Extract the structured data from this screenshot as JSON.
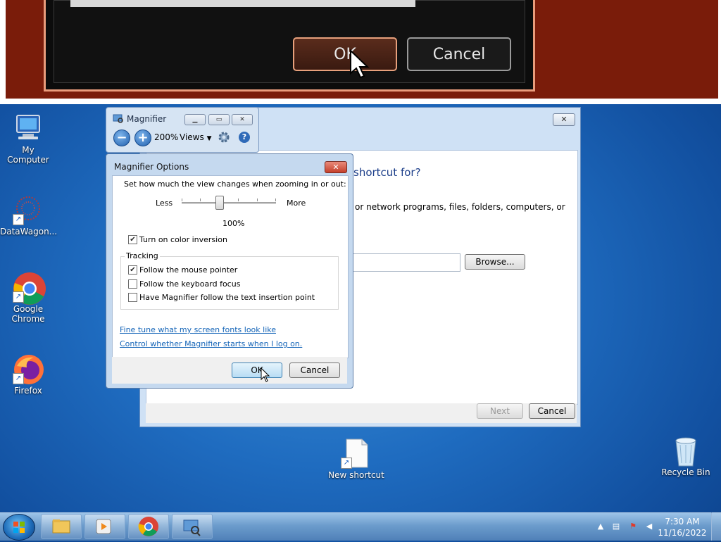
{
  "lens": {
    "ok_label": "OK",
    "cancel_label": "Cancel"
  },
  "desktop": {
    "icons": [
      {
        "label": "My Computer"
      },
      {
        "label": "DataWagon..."
      },
      {
        "label": "Google Chrome"
      },
      {
        "label": "Firefox"
      },
      {
        "label": "New shortcut"
      },
      {
        "label": "Recycle Bin"
      }
    ]
  },
  "wizard": {
    "heading_fragment": "shortcut for?",
    "desc_fragment": "or network programs, files, folders, computers, or",
    "browse_label": "Browse...",
    "next_label": "Next",
    "cancel_label": "Cancel",
    "close_glyph": "✕"
  },
  "magnifier": {
    "title": "Magnifier",
    "zoom": "200%",
    "views_label": "Views",
    "minus": "−",
    "plus": "+"
  },
  "options": {
    "title": "Magnifier Options",
    "zoom_prompt": "Set how much the view changes when zooming in or out:",
    "less_label": "Less",
    "more_label": "More",
    "step_value": "100%",
    "step_fraction": 0.4,
    "color_inversion_label": "Turn on color inversion",
    "color_inversion_checked": true,
    "tracking_label": "Tracking",
    "tracking": [
      {
        "label": "Follow the mouse pointer",
        "checked": true
      },
      {
        "label": "Follow the keyboard focus",
        "checked": false
      },
      {
        "label": "Have Magnifier follow the text insertion point",
        "checked": false
      }
    ],
    "link_fonts": "Fine tune what my screen fonts look like",
    "link_startup": "Control whether Magnifier starts when I log on.",
    "ok_label": "OK",
    "cancel_label": "Cancel"
  },
  "taskbar": {
    "time": "7:30 AM",
    "date": "11/16/2022"
  },
  "colors": {
    "link": "#1565b8",
    "desktop_blue": "#1f6cc0",
    "lens_accent": "#e99c7c"
  }
}
